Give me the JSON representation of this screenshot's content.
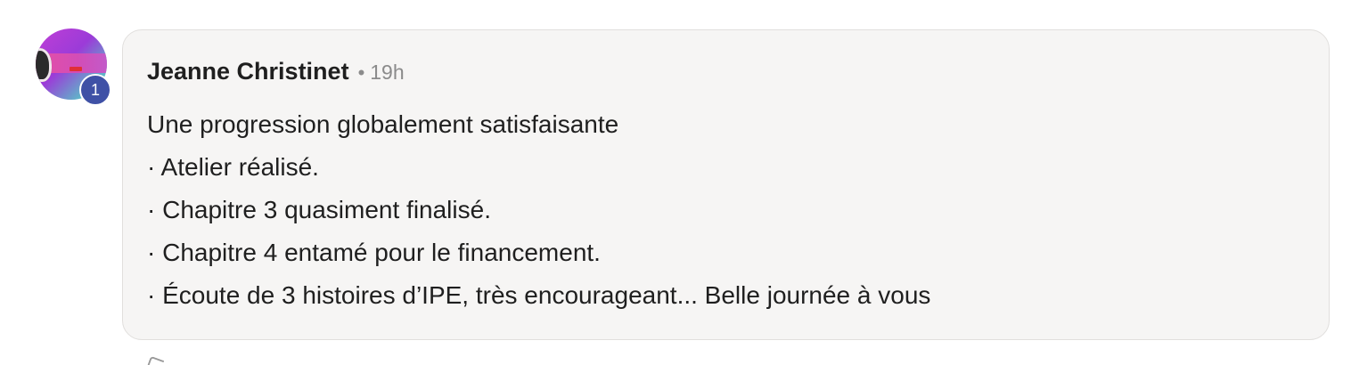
{
  "comment": {
    "author": "Jeanne Christinet",
    "separator": "•",
    "timestamp": "19h",
    "badge_count": "1",
    "lines": [
      "Une progression globalement satisfaisante",
      "· Atelier réalisé.",
      "· Chapitre 3 quasiment finalisé.",
      "· Chapitre 4 entamé pour le financement.",
      "· Écoute de 3 histoires d’IPE, très encourageant... Belle journée à vous"
    ]
  },
  "colors": {
    "bubble_bg": "#f6f5f4",
    "badge_bg": "#3f51a6",
    "text": "#1f1f1f",
    "muted": "#8b8b8b"
  },
  "icons": {
    "below_bubble": "reaction-icon"
  }
}
